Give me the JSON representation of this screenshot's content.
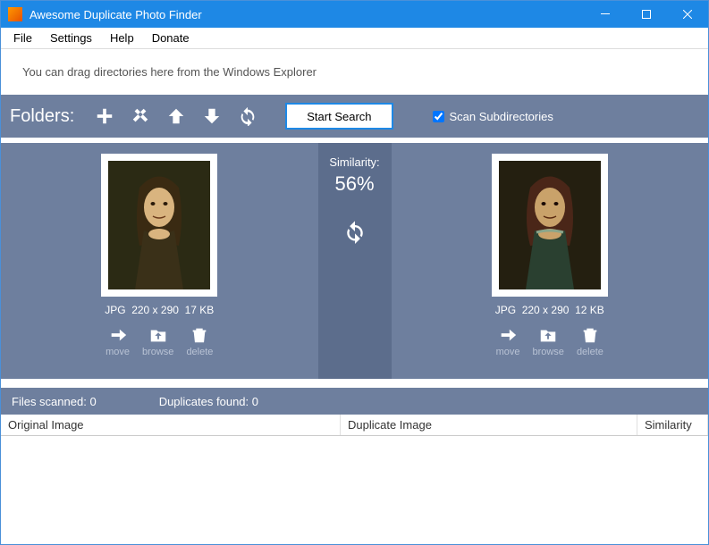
{
  "window": {
    "title": "Awesome Duplicate Photo Finder"
  },
  "menu": {
    "file": "File",
    "settings": "Settings",
    "help": "Help",
    "donate": "Donate"
  },
  "dropzone": {
    "hint": "You can drag directories here from the Windows Explorer"
  },
  "toolbar": {
    "folders_label": "Folders:",
    "start_search": "Start Search",
    "scan_subdirs": "Scan Subdirectories",
    "scan_subdirs_checked": true
  },
  "comparison": {
    "similarity_label": "Similarity:",
    "similarity_value": "56%",
    "left": {
      "format": "JPG",
      "dimensions": "220 x 290",
      "size": "17 KB"
    },
    "right": {
      "format": "JPG",
      "dimensions": "220 x 290",
      "size": "12 KB"
    },
    "actions": {
      "move": "move",
      "browse": "browse",
      "delete": "delete"
    }
  },
  "status": {
    "files_scanned_label": "Files scanned:",
    "files_scanned_value": "0",
    "duplicates_found_label": "Duplicates found:",
    "duplicates_found_value": "0"
  },
  "results": {
    "col_original": "Original Image",
    "col_duplicate": "Duplicate Image",
    "col_similarity": "Similarity"
  }
}
